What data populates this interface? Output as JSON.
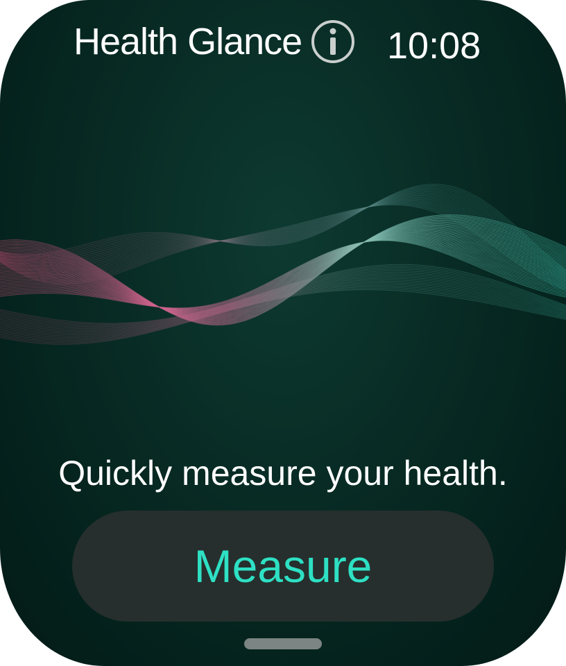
{
  "header": {
    "title": "Health Glance",
    "info_icon": "info-icon",
    "time": "10:08"
  },
  "main": {
    "illustration": "wave-graphic",
    "prompt": "Quickly measure your health."
  },
  "actions": {
    "measure_label": "Measure"
  },
  "colors": {
    "background": "#082b24",
    "accent": "#2ee0c4",
    "button_background": "#262f2d",
    "wave_pink": "#e0517f",
    "wave_teal": "#3fc9b0"
  }
}
